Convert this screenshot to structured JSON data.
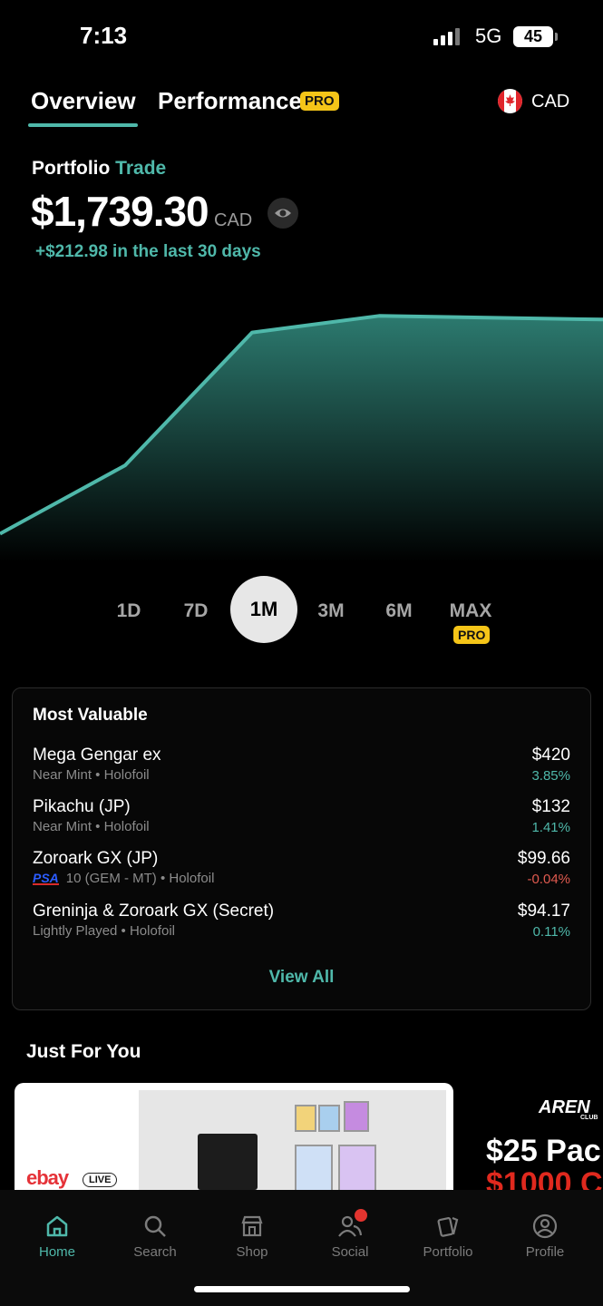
{
  "status_bar": {
    "time": "7:13",
    "network": "5G",
    "battery": "45"
  },
  "header": {
    "tabs": [
      {
        "label": "Overview"
      },
      {
        "label": "Performance"
      }
    ],
    "pro_badge": "PRO",
    "currency": "CAD"
  },
  "portfolio": {
    "label": "Portfolio",
    "name": "Trade",
    "value": "$1,739.30",
    "value_currency": "CAD",
    "change": "+$212.98 in the last 30 days"
  },
  "chart_data": {
    "type": "area",
    "x": [
      0,
      1,
      2,
      3,
      4
    ],
    "y": [
      1520,
      1590,
      1726,
      1743,
      1739.3
    ],
    "ylim": [
      1500,
      1760
    ],
    "colors": {
      "line": "#4fb8aa",
      "fill": "#2c7a6f"
    }
  },
  "ranges": {
    "items": [
      "1D",
      "7D",
      "1M",
      "3M",
      "6M",
      "MAX"
    ],
    "selected": "1M",
    "max_badge": "PRO"
  },
  "most_valuable": {
    "title": "Most Valuable",
    "items": [
      {
        "name": "Mega Gengar ex",
        "detail": "Near Mint • Holofoil",
        "price": "$420",
        "change": "3.85%"
      },
      {
        "name": "Pikachu (JP)",
        "detail": "Near Mint • Holofoil",
        "price": "$132",
        "change": "1.41%"
      },
      {
        "name": "Zoroark GX (JP)",
        "grader": "PSA",
        "detail": "10 (GEM - MT) • Holofoil",
        "price": "$99.66",
        "change": "-0.04%"
      },
      {
        "name": "Greninja & Zoroark GX (Secret)",
        "detail": "Lightly Played • Holofoil",
        "price": "$94.17",
        "change": "0.11%"
      }
    ],
    "view_all": "View All"
  },
  "just_for_you": {
    "title": "Just For You",
    "promo1": {
      "brand": "ebay",
      "badge": "LIVE"
    },
    "promo2": {
      "brand": "AREN",
      "sub": "CLUB",
      "line1": "$25 Pac",
      "line2": "$1000 C"
    }
  },
  "nav": {
    "items": [
      {
        "label": "Home",
        "icon": "home-icon"
      },
      {
        "label": "Search",
        "icon": "search-icon"
      },
      {
        "label": "Shop",
        "icon": "shop-icon"
      },
      {
        "label": "Social",
        "icon": "social-icon"
      },
      {
        "label": "Portfolio",
        "icon": "portfolio-icon"
      },
      {
        "label": "Profile",
        "icon": "profile-icon"
      }
    ],
    "active": "Home",
    "accent": "#4fb8aa"
  }
}
